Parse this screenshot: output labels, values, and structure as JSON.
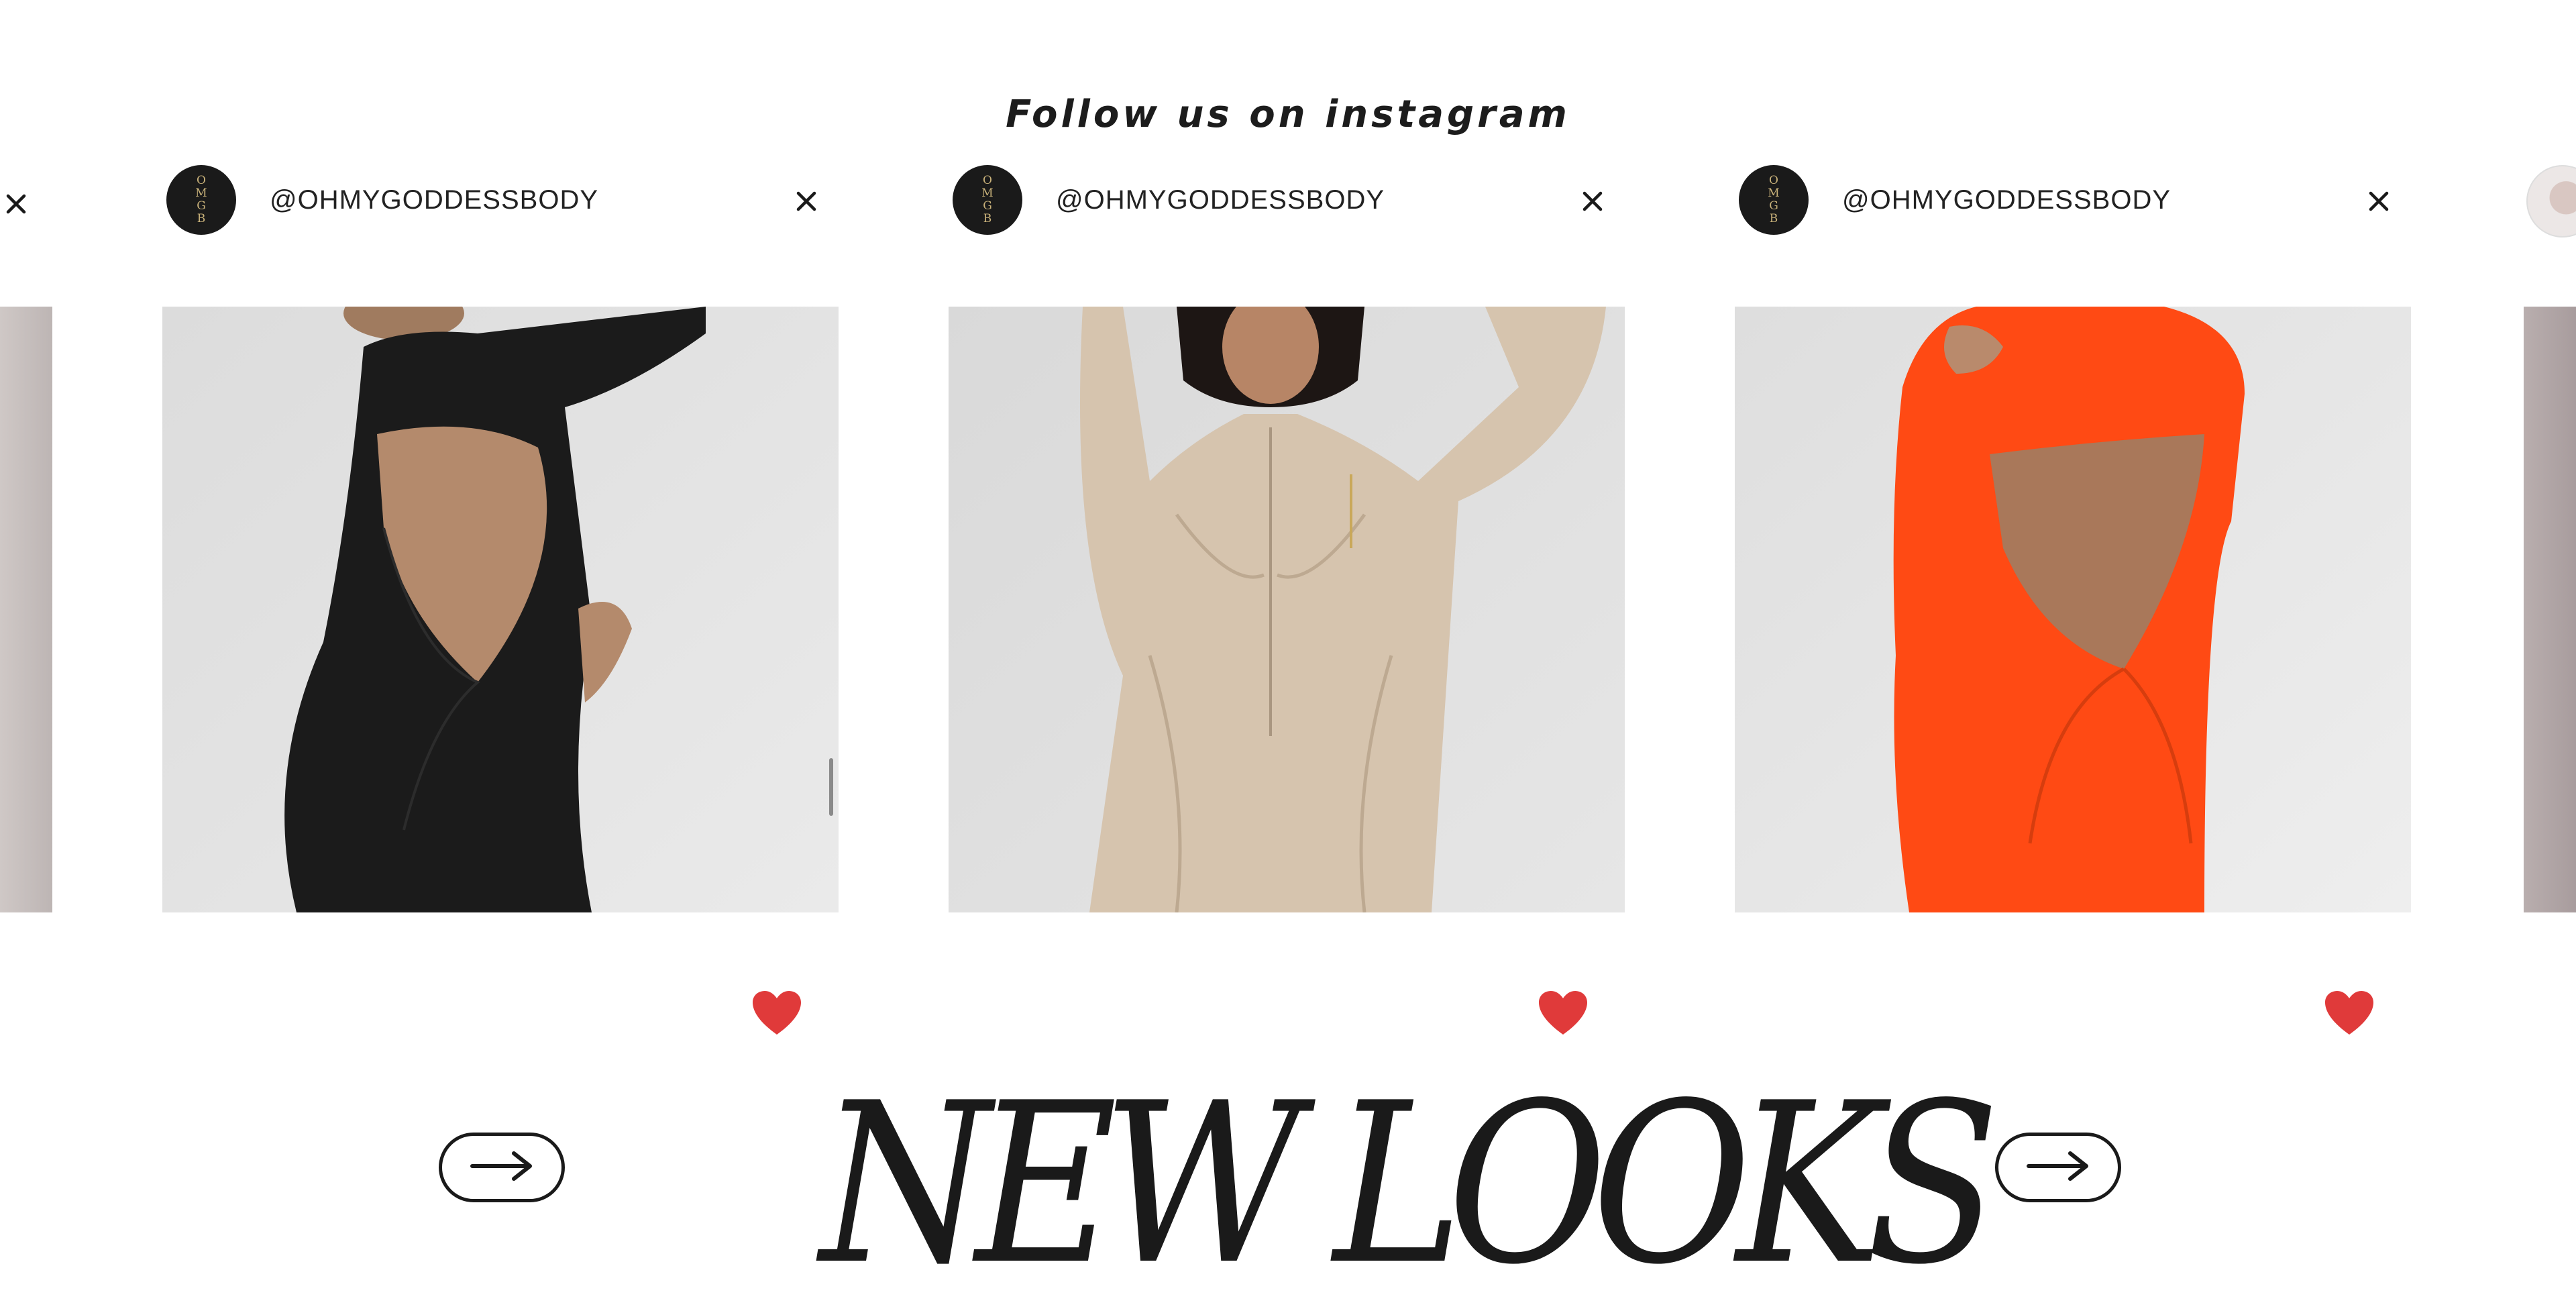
{
  "section": {
    "heading": "Follow us on instagram",
    "title": "NEW LOOKS"
  },
  "logo_letters": [
    "O",
    "M",
    "G",
    "B"
  ],
  "posts": [
    {
      "handle": "@OHMYGODDESSBODY",
      "outfit": "black open-back long-sleeve jumpsuit",
      "outfit_color": "#1b1b1b"
    },
    {
      "handle": "@OHMYGODDESSBODY",
      "outfit": "beige zip-front long-sleeve jumpsuit",
      "outfit_color": "#d6c4ae"
    },
    {
      "handle": "@OHMYGODDESSBODY",
      "outfit": "orange open-back long-sleeve jumpsuit",
      "outfit_color": "#ff4a14"
    }
  ],
  "colors": {
    "heart": "#e03a3a",
    "text": "#1a1a1a",
    "avatar_bg": "#1a1a1a",
    "logo_gold": "#c9b27a",
    "photo_bg": "#e2e2e2"
  },
  "icons": {
    "close": "close-icon",
    "like": "heart-icon",
    "next": "arrow-right-icon"
  }
}
